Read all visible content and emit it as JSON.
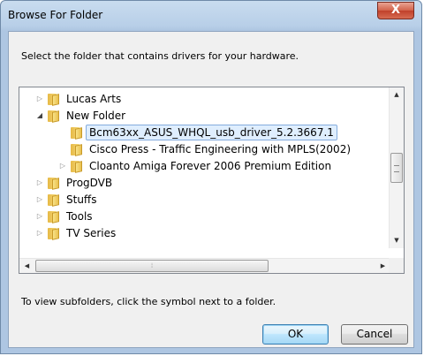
{
  "window": {
    "title": "Browse For Folder",
    "close_glyph": "X"
  },
  "instruction": "Select the folder that contains drivers for your hardware.",
  "tree": {
    "items": [
      {
        "label": "Lucas Arts",
        "expander": "collapsed",
        "level": 1
      },
      {
        "label": "New Folder",
        "expander": "expanded",
        "level": 1
      },
      {
        "label": "Bcm63xx_ASUS_WHQL_usb_driver_5.2.3667.1",
        "expander": "none",
        "level": 2,
        "selected": true
      },
      {
        "label": "Cisco Press - Traffic Engineering with MPLS(2002)",
        "expander": "none",
        "level": 2
      },
      {
        "label": "Cloanto Amiga Forever 2006 Premium Edition",
        "expander": "collapsed",
        "level": 2
      },
      {
        "label": "ProgDVB",
        "expander": "collapsed",
        "level": 1
      },
      {
        "label": "Stuffs",
        "expander": "collapsed",
        "level": 1
      },
      {
        "label": "Tools",
        "expander": "collapsed",
        "level": 1
      },
      {
        "label": "TV Series",
        "expander": "collapsed",
        "level": 1
      }
    ]
  },
  "hint": "To view subfolders, click the symbol next to a folder.",
  "buttons": {
    "ok": "OK",
    "cancel": "Cancel"
  },
  "glyphs": {
    "collapsed": "▷",
    "expanded": "◢",
    "up": "▲",
    "down": "▼",
    "left": "◀",
    "right": "▶",
    "grip": "⦙"
  },
  "colors": {
    "selection_bg": "#dfeefe",
    "selection_border": "#84acdd",
    "close_button": "#c0402a",
    "title_bar": "#b8cfe8"
  }
}
